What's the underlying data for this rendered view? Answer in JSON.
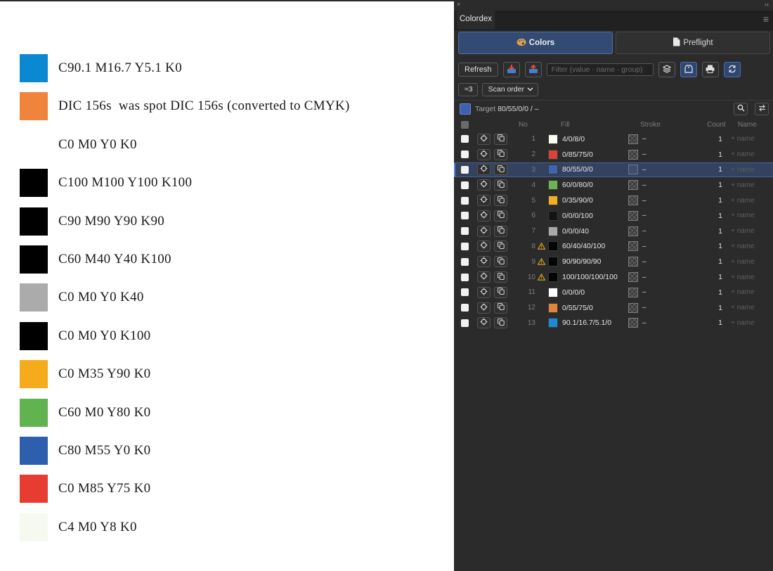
{
  "document": {
    "swatches": [
      {
        "color": "#0a88d2",
        "label": "C90.1 M16.7 Y5.1 K0"
      },
      {
        "color": "#f0843c",
        "label": "DIC 156s  was spot DIC 156s (converted to CMYK)"
      },
      {
        "color": "#ffffff",
        "label": "C0 M0 Y0 K0"
      },
      {
        "color": "#000000",
        "label": "C100 M100 Y100 K100"
      },
      {
        "color": "#000000",
        "label": "C90 M90 Y90 K90"
      },
      {
        "color": "#000000",
        "label": "C60 M40 Y40 K100"
      },
      {
        "color": "#ababab",
        "label": "C0 M0 Y0 K40"
      },
      {
        "color": "#000000",
        "label": "C0 M0 Y0 K100"
      },
      {
        "color": "#f6ab1d",
        "label": "C0 M35 Y90 K0"
      },
      {
        "color": "#60b34f",
        "label": "C60 M0 Y80 K0"
      },
      {
        "color": "#2d5fae",
        "label": "C80 M55 Y0 K0"
      },
      {
        "color": "#e73c32",
        "label": "C0 M85 Y75 K0"
      },
      {
        "color": "#f6f9ef",
        "label": "C4 M0 Y8 K0"
      }
    ]
  },
  "panel": {
    "close_glyph": "×",
    "collapse_glyph": "‹‹",
    "tab_title": "Colordex",
    "menu_glyph": "≡",
    "mode_colors_label": "Colors",
    "mode_preflight_label": "Preflight",
    "refresh_label": "Refresh",
    "filter_placeholder": "Filter (value · name · group)",
    "group_label": "≈3",
    "sort_selected": "Scan order",
    "target_label": "Target",
    "target_value": "80/55/0/0 / –",
    "columns": {
      "no": "No",
      "fill": "Fill",
      "stroke": "Stroke",
      "count": "Count",
      "name": "Name"
    },
    "stroke_none": "–",
    "name_placeholder": "+ name",
    "accent_color": "#4d6fa6",
    "rows": [
      {
        "no": "1",
        "fill_color": "#fbfbef",
        "fill": "4/0/8/0",
        "count": "1",
        "warn": false,
        "selected": false
      },
      {
        "no": "2",
        "fill_color": "#d94238",
        "fill": "0/85/75/0",
        "count": "1",
        "warn": false,
        "selected": false
      },
      {
        "no": "3",
        "fill_color": "#3f64b4",
        "fill": "80/55/0/0",
        "count": "1",
        "warn": false,
        "selected": true
      },
      {
        "no": "4",
        "fill_color": "#6cb452",
        "fill": "60/0/80/0",
        "count": "1",
        "warn": false,
        "selected": false
      },
      {
        "no": "5",
        "fill_color": "#f3ad22",
        "fill": "0/35/90/0",
        "count": "1",
        "warn": false,
        "selected": false
      },
      {
        "no": "6",
        "fill_color": "#141414",
        "fill": "0/0/0/100",
        "count": "1",
        "warn": false,
        "selected": false
      },
      {
        "no": "7",
        "fill_color": "#a8a8a8",
        "fill": "0/0/0/40",
        "count": "1",
        "warn": false,
        "selected": false
      },
      {
        "no": "8",
        "fill_color": "#050505",
        "fill": "60/40/40/100",
        "count": "1",
        "warn": true,
        "selected": false
      },
      {
        "no": "9",
        "fill_color": "#050505",
        "fill": "90/90/90/90",
        "count": "1",
        "warn": true,
        "selected": false
      },
      {
        "no": "10",
        "fill_color": "#050505",
        "fill": "100/100/100/100",
        "count": "1",
        "warn": true,
        "selected": false
      },
      {
        "no": "11",
        "fill_color": "#ffffff",
        "fill": "0/0/0/0",
        "count": "1",
        "warn": false,
        "selected": false
      },
      {
        "no": "12",
        "fill_color": "#e38536",
        "fill": "0/55/75/0",
        "count": "1",
        "warn": false,
        "selected": false
      },
      {
        "no": "13",
        "fill_color": "#1b8bd4",
        "fill": "90.1/16.7/5.1/0",
        "count": "1",
        "warn": false,
        "selected": false
      }
    ]
  }
}
